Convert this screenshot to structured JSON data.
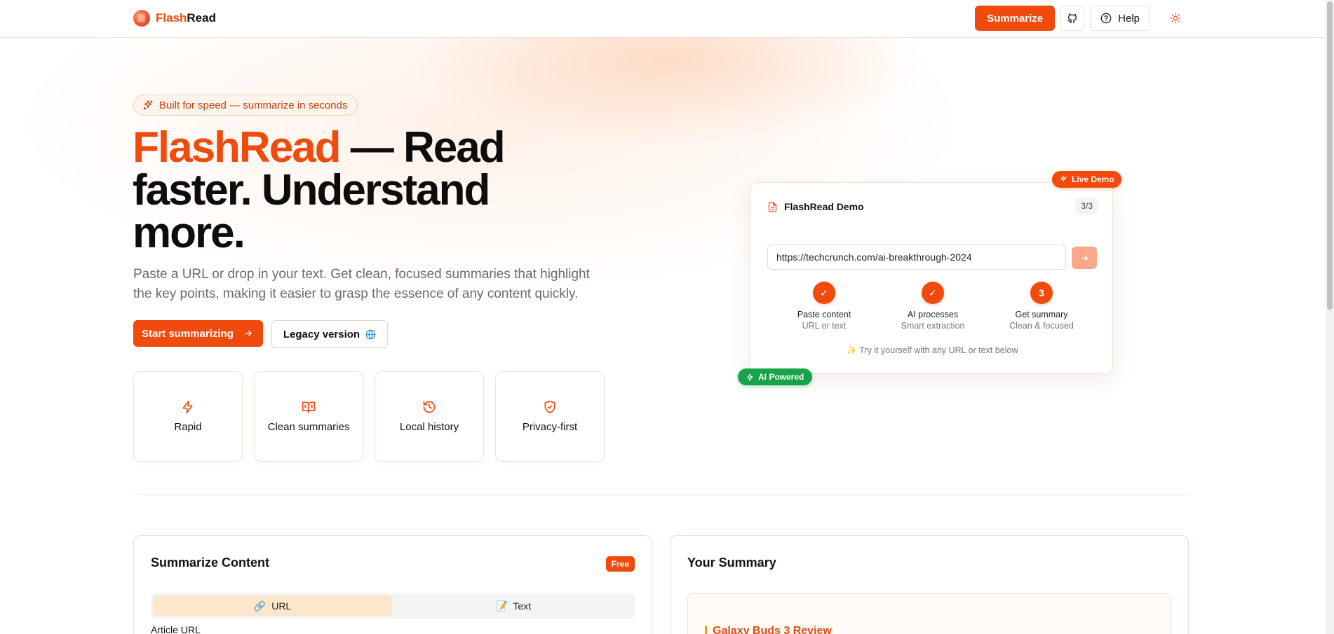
{
  "header": {
    "brand_part1": "Flash",
    "brand_part2": "Read",
    "summarize_label": "Summarize",
    "help_label": "Help"
  },
  "hero": {
    "badge": "Built for speed — summarize in seconds",
    "title_accent": "FlashRead",
    "title_rest": " — Read faster. Understand more.",
    "subtitle": "Paste a URL or drop in your text. Get clean, focused summaries that highlight the key points, making it easier to grasp the essence of any content quickly.",
    "cta_primary": "Start summarizing",
    "cta_secondary": "Legacy version"
  },
  "features": [
    {
      "label": "Rapid",
      "icon": "bolt-icon"
    },
    {
      "label": "Clean summaries",
      "icon": "book-open-icon"
    },
    {
      "label": "Local history",
      "icon": "history-icon"
    },
    {
      "label": "Privacy-first",
      "icon": "shield-check-icon"
    }
  ],
  "demo": {
    "live_label": "Live Demo",
    "ai_label": "AI Powered",
    "title": "FlashRead Demo",
    "count": "3/3",
    "url_value": "https://techcrunch.com/ai-breakthrough-2024",
    "steps": [
      {
        "mark": "✓",
        "title": "Paste content",
        "sub": "URL or text"
      },
      {
        "mark": "✓",
        "title": "AI processes",
        "sub": "Smart extraction"
      },
      {
        "mark": "3",
        "title": "Get summary",
        "sub": "Clean & focused"
      }
    ],
    "hint": "✨ Try it yourself with any URL or text below"
  },
  "summarize_card": {
    "title": "Summarize Content",
    "badge": "Free",
    "tabs": [
      {
        "label": "URL",
        "icon": "link-icon",
        "active": true
      },
      {
        "label": "Text",
        "icon": "memo-icon",
        "active": false
      }
    ],
    "field_label": "Article URL"
  },
  "summary_card": {
    "title": "Your Summary",
    "headline": "Galaxy Buds 3 Review"
  },
  "colors": {
    "accent": "#f04a0c",
    "success": "#16a34a",
    "badge_bg": "#fff4ec"
  }
}
